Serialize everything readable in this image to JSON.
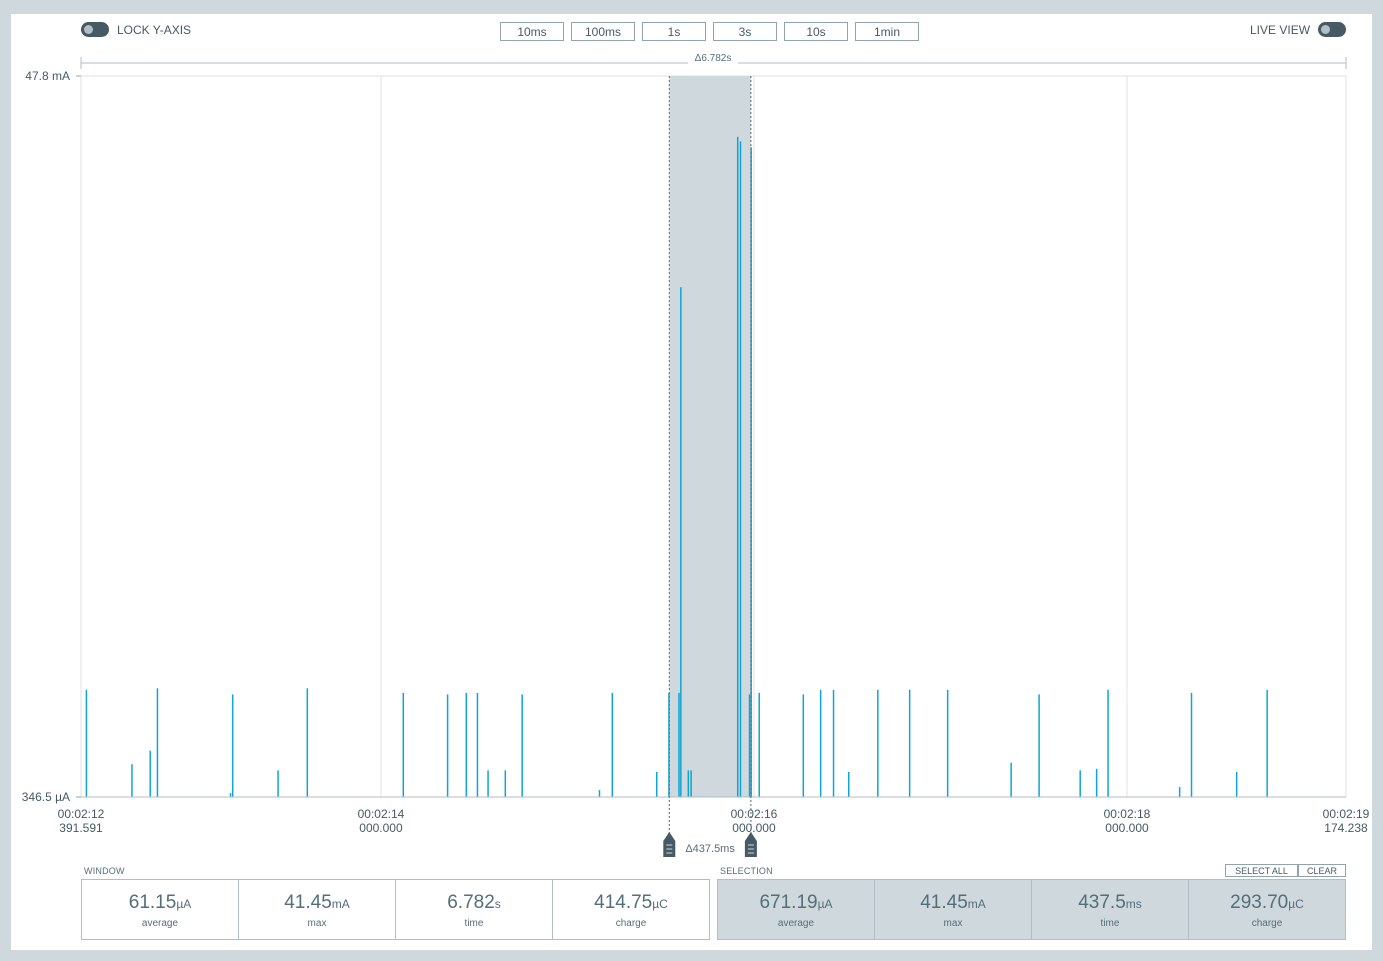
{
  "toolbar": {
    "lock_y_axis_label": "LOCK Y-AXIS",
    "live_view_label": "LIVE VIEW",
    "zoom_buttons": [
      "10ms",
      "100ms",
      "1s",
      "3s",
      "10s",
      "1min"
    ]
  },
  "window_delta": "Δ6.782s",
  "selection_delta": "Δ437.5ms",
  "chart_data": {
    "type": "line",
    "ylabel": "",
    "y_max_label": "47.8 mA",
    "y_min_label": "346.5 µA",
    "x_range_s": [
      132.391591,
      139.174238
    ],
    "x_tick_labels": [
      {
        "t": 132.391591,
        "line1": "00:02:12",
        "line2": "391.591"
      },
      {
        "t": 134.0,
        "line1": "00:02:14",
        "line2": "000.000"
      },
      {
        "t": 136.0,
        "line1": "00:02:16",
        "line2": "000.000"
      },
      {
        "t": 138.0,
        "line1": "00:02:18",
        "line2": "000.000"
      },
      {
        "t": 139.174238,
        "line1": "00:02:19",
        "line2": "174.238"
      }
    ],
    "grid_x_s": [
      134.0,
      136.0,
      138.0
    ],
    "selection_s": [
      135.5459,
      135.9834
    ],
    "series": [
      {
        "color": "#0ea5d4",
        "spikes_mA": [
          [
            132.4206,
            7.4
          ],
          [
            132.6648,
            2.5
          ],
          [
            132.7627,
            3.4
          ],
          [
            132.8014,
            7.5
          ],
          [
            133.1932,
            0.6
          ],
          [
            133.2049,
            7.1
          ],
          [
            133.4482,
            2.1
          ],
          [
            133.6051,
            7.5
          ],
          [
            134.1197,
            7.2
          ],
          [
            134.3572,
            7.1
          ],
          [
            134.4575,
            7.2
          ],
          [
            134.5173,
            7.2
          ],
          [
            134.5742,
            2.1
          ],
          [
            134.6667,
            2.1
          ],
          [
            134.7569,
            7.1
          ],
          [
            135.1716,
            0.8
          ],
          [
            135.2404,
            7.2
          ],
          [
            135.4787,
            2.0
          ],
          [
            135.544,
            7.2
          ],
          [
            135.598,
            7.2
          ],
          [
            135.6078,
            33.9
          ],
          [
            135.648,
            2.1
          ],
          [
            135.663,
            2.1
          ],
          [
            135.9127,
            43.8
          ],
          [
            135.9275,
            43.5
          ],
          [
            135.9762,
            7.1
          ],
          [
            135.985,
            43.1
          ],
          [
            136.0281,
            7.2
          ],
          [
            136.2645,
            7.1
          ],
          [
            136.3574,
            7.4
          ],
          [
            136.4265,
            7.4
          ],
          [
            136.5081,
            2.0
          ],
          [
            136.664,
            7.4
          ],
          [
            136.8346,
            7.4
          ],
          [
            137.0384,
            7.4
          ],
          [
            137.3787,
            2.6
          ],
          [
            137.5287,
            7.1
          ],
          [
            137.7491,
            2.1
          ],
          [
            137.8372,
            2.2
          ],
          [
            137.8984,
            7.4
          ],
          [
            138.2822,
            1.0
          ],
          [
            138.3459,
            7.2
          ],
          [
            138.5879,
            2.0
          ],
          [
            138.7515,
            7.4
          ]
        ]
      }
    ]
  },
  "window_stats": {
    "title": "WINDOW",
    "items": [
      {
        "value": "61.15",
        "unit": "µA",
        "label": "average"
      },
      {
        "value": "41.45",
        "unit": "mA",
        "label": "max"
      },
      {
        "value": "6.782",
        "unit": "s",
        "label": "time"
      },
      {
        "value": "414.75",
        "unit": "µC",
        "label": "charge"
      }
    ]
  },
  "selection_stats": {
    "title": "SELECTION",
    "select_all_label": "SELECT ALL",
    "clear_label": "CLEAR",
    "items": [
      {
        "value": "671.19",
        "unit": "µA",
        "label": "average"
      },
      {
        "value": "41.45",
        "unit": "mA",
        "label": "max"
      },
      {
        "value": "437.5",
        "unit": "ms",
        "label": "time"
      },
      {
        "value": "293.70",
        "unit": "µC",
        "label": "charge"
      }
    ]
  },
  "colors": {
    "background": "#cfd8dc",
    "panel": "#ffffff",
    "trace": "#0ea5d4",
    "selection_fill": "#cfd8dc",
    "toggle": "#455a64"
  }
}
